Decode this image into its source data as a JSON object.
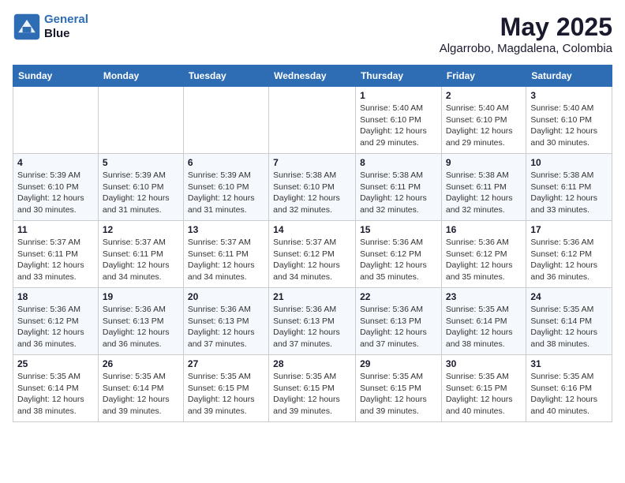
{
  "header": {
    "logo_line1": "General",
    "logo_line2": "Blue",
    "title": "May 2025",
    "subtitle": "Algarrobo, Magdalena, Colombia"
  },
  "weekdays": [
    "Sunday",
    "Monday",
    "Tuesday",
    "Wednesday",
    "Thursday",
    "Friday",
    "Saturday"
  ],
  "weeks": [
    [
      {
        "day": "",
        "info": ""
      },
      {
        "day": "",
        "info": ""
      },
      {
        "day": "",
        "info": ""
      },
      {
        "day": "",
        "info": ""
      },
      {
        "day": "1",
        "info": "Sunrise: 5:40 AM\nSunset: 6:10 PM\nDaylight: 12 hours\nand 29 minutes."
      },
      {
        "day": "2",
        "info": "Sunrise: 5:40 AM\nSunset: 6:10 PM\nDaylight: 12 hours\nand 29 minutes."
      },
      {
        "day": "3",
        "info": "Sunrise: 5:40 AM\nSunset: 6:10 PM\nDaylight: 12 hours\nand 30 minutes."
      }
    ],
    [
      {
        "day": "4",
        "info": "Sunrise: 5:39 AM\nSunset: 6:10 PM\nDaylight: 12 hours\nand 30 minutes."
      },
      {
        "day": "5",
        "info": "Sunrise: 5:39 AM\nSunset: 6:10 PM\nDaylight: 12 hours\nand 31 minutes."
      },
      {
        "day": "6",
        "info": "Sunrise: 5:39 AM\nSunset: 6:10 PM\nDaylight: 12 hours\nand 31 minutes."
      },
      {
        "day": "7",
        "info": "Sunrise: 5:38 AM\nSunset: 6:10 PM\nDaylight: 12 hours\nand 32 minutes."
      },
      {
        "day": "8",
        "info": "Sunrise: 5:38 AM\nSunset: 6:11 PM\nDaylight: 12 hours\nand 32 minutes."
      },
      {
        "day": "9",
        "info": "Sunrise: 5:38 AM\nSunset: 6:11 PM\nDaylight: 12 hours\nand 32 minutes."
      },
      {
        "day": "10",
        "info": "Sunrise: 5:38 AM\nSunset: 6:11 PM\nDaylight: 12 hours\nand 33 minutes."
      }
    ],
    [
      {
        "day": "11",
        "info": "Sunrise: 5:37 AM\nSunset: 6:11 PM\nDaylight: 12 hours\nand 33 minutes."
      },
      {
        "day": "12",
        "info": "Sunrise: 5:37 AM\nSunset: 6:11 PM\nDaylight: 12 hours\nand 34 minutes."
      },
      {
        "day": "13",
        "info": "Sunrise: 5:37 AM\nSunset: 6:11 PM\nDaylight: 12 hours\nand 34 minutes."
      },
      {
        "day": "14",
        "info": "Sunrise: 5:37 AM\nSunset: 6:12 PM\nDaylight: 12 hours\nand 34 minutes."
      },
      {
        "day": "15",
        "info": "Sunrise: 5:36 AM\nSunset: 6:12 PM\nDaylight: 12 hours\nand 35 minutes."
      },
      {
        "day": "16",
        "info": "Sunrise: 5:36 AM\nSunset: 6:12 PM\nDaylight: 12 hours\nand 35 minutes."
      },
      {
        "day": "17",
        "info": "Sunrise: 5:36 AM\nSunset: 6:12 PM\nDaylight: 12 hours\nand 36 minutes."
      }
    ],
    [
      {
        "day": "18",
        "info": "Sunrise: 5:36 AM\nSunset: 6:12 PM\nDaylight: 12 hours\nand 36 minutes."
      },
      {
        "day": "19",
        "info": "Sunrise: 5:36 AM\nSunset: 6:13 PM\nDaylight: 12 hours\nand 36 minutes."
      },
      {
        "day": "20",
        "info": "Sunrise: 5:36 AM\nSunset: 6:13 PM\nDaylight: 12 hours\nand 37 minutes."
      },
      {
        "day": "21",
        "info": "Sunrise: 5:36 AM\nSunset: 6:13 PM\nDaylight: 12 hours\nand 37 minutes."
      },
      {
        "day": "22",
        "info": "Sunrise: 5:36 AM\nSunset: 6:13 PM\nDaylight: 12 hours\nand 37 minutes."
      },
      {
        "day": "23",
        "info": "Sunrise: 5:35 AM\nSunset: 6:14 PM\nDaylight: 12 hours\nand 38 minutes."
      },
      {
        "day": "24",
        "info": "Sunrise: 5:35 AM\nSunset: 6:14 PM\nDaylight: 12 hours\nand 38 minutes."
      }
    ],
    [
      {
        "day": "25",
        "info": "Sunrise: 5:35 AM\nSunset: 6:14 PM\nDaylight: 12 hours\nand 38 minutes."
      },
      {
        "day": "26",
        "info": "Sunrise: 5:35 AM\nSunset: 6:14 PM\nDaylight: 12 hours\nand 39 minutes."
      },
      {
        "day": "27",
        "info": "Sunrise: 5:35 AM\nSunset: 6:15 PM\nDaylight: 12 hours\nand 39 minutes."
      },
      {
        "day": "28",
        "info": "Sunrise: 5:35 AM\nSunset: 6:15 PM\nDaylight: 12 hours\nand 39 minutes."
      },
      {
        "day": "29",
        "info": "Sunrise: 5:35 AM\nSunset: 6:15 PM\nDaylight: 12 hours\nand 39 minutes."
      },
      {
        "day": "30",
        "info": "Sunrise: 5:35 AM\nSunset: 6:15 PM\nDaylight: 12 hours\nand 40 minutes."
      },
      {
        "day": "31",
        "info": "Sunrise: 5:35 AM\nSunset: 6:16 PM\nDaylight: 12 hours\nand 40 minutes."
      }
    ]
  ]
}
